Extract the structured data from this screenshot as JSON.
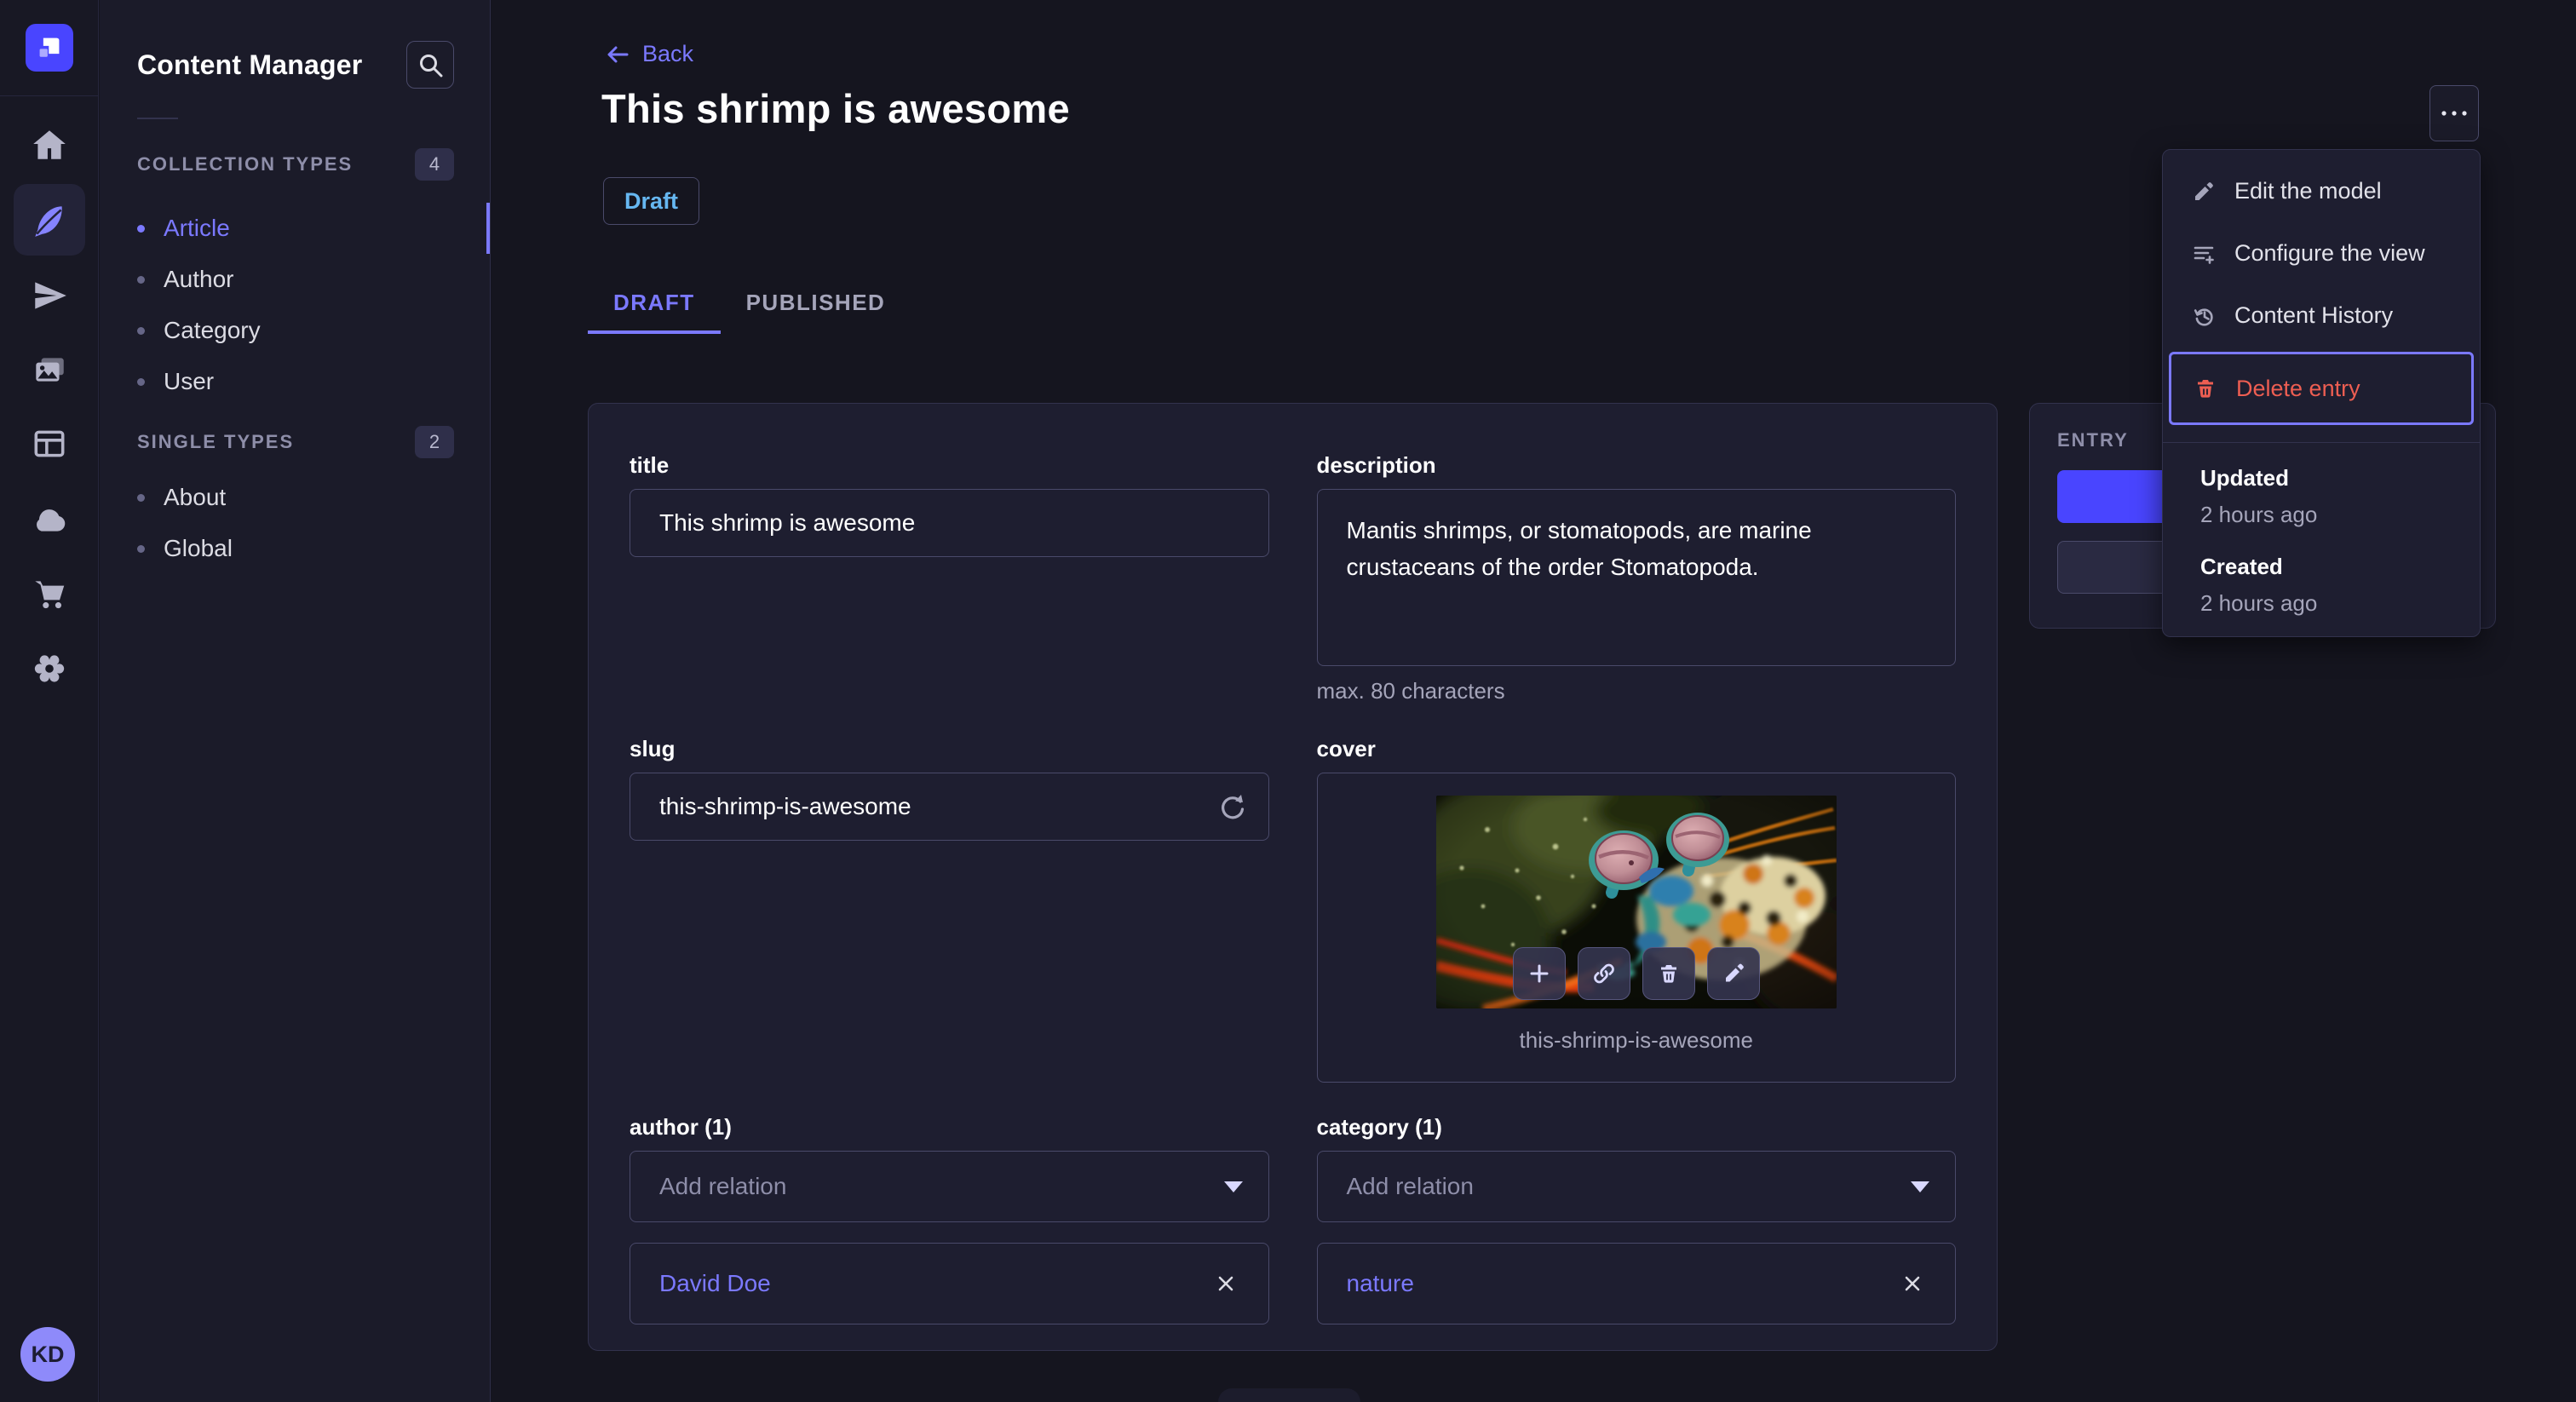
{
  "colors": {
    "accent": "#4945ff",
    "link": "#7b79ff",
    "danger": "#ee5e52",
    "draft_blue": "#66b7f1"
  },
  "nav": {
    "icons": [
      "home-icon",
      "feather-icon",
      "paper-plane-icon",
      "media-library-icon",
      "content-builder-icon",
      "cloud-icon",
      "marketplace-cart-icon",
      "settings-gear-icon"
    ],
    "avatar_initials": "KD"
  },
  "subnav": {
    "title": "Content Manager",
    "sections": [
      {
        "label": "COLLECTION TYPES",
        "count": "4",
        "items": [
          {
            "label": "Article"
          },
          {
            "label": "Author"
          },
          {
            "label": "Category"
          },
          {
            "label": "User"
          }
        ]
      },
      {
        "label": "SINGLE TYPES",
        "count": "2",
        "items": [
          {
            "label": "About"
          },
          {
            "label": "Global"
          }
        ]
      }
    ]
  },
  "header": {
    "back_label": "Back",
    "title": "This shrimp is awesome",
    "status": "Draft",
    "tabs": [
      {
        "label": "DRAFT"
      },
      {
        "label": "PUBLISHED"
      }
    ]
  },
  "form": {
    "title": {
      "label": "title",
      "value": "This shrimp is awesome"
    },
    "description": {
      "label": "description",
      "value": "Mantis shrimps, or stomatopods, are marine crustaceans of the order Stomatopoda.",
      "hint": "max. 80 characters"
    },
    "slug": {
      "label": "slug",
      "value": "this-shrimp-is-awesome"
    },
    "cover": {
      "label": "cover",
      "filename": "this-shrimp-is-awesome"
    },
    "author": {
      "label": "author (1)",
      "placeholder": "Add relation",
      "relation": "David Doe"
    },
    "category": {
      "label": "category (1)",
      "placeholder": "Add relation",
      "relation": "nature"
    }
  },
  "entry_panel": {
    "label": "ENTRY"
  },
  "menu": {
    "items": [
      {
        "label": "Edit the model"
      },
      {
        "label": "Configure the view"
      },
      {
        "label": "Content History"
      },
      {
        "label": "Delete entry"
      }
    ],
    "meta": [
      {
        "label": "Updated",
        "value": "2 hours ago"
      },
      {
        "label": "Created",
        "value": "2 hours ago"
      }
    ]
  }
}
